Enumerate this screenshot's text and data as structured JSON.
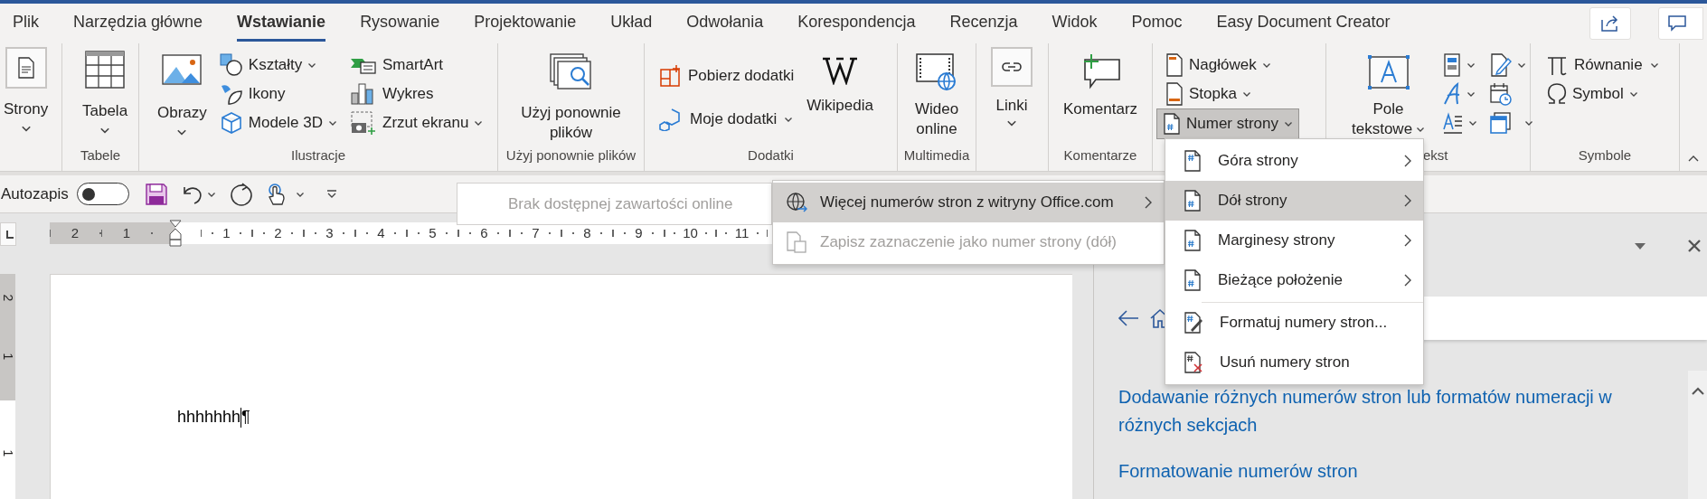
{
  "tabs": [
    {
      "label": "Plik",
      "selected": false
    },
    {
      "label": "Narzędzia główne",
      "selected": false
    },
    {
      "label": "Wstawianie",
      "selected": true
    },
    {
      "label": "Rysowanie",
      "selected": false
    },
    {
      "label": "Projektowanie",
      "selected": false
    },
    {
      "label": "Układ",
      "selected": false
    },
    {
      "label": "Odwołania",
      "selected": false
    },
    {
      "label": "Korespondencja",
      "selected": false
    },
    {
      "label": "Recenzja",
      "selected": false
    },
    {
      "label": "Widok",
      "selected": false
    },
    {
      "label": "Pomoc",
      "selected": false
    },
    {
      "label": "Easy Document Creator",
      "selected": false
    }
  ],
  "ribbon": {
    "pages": {
      "button": "Strony"
    },
    "tables": {
      "button": "Tabela",
      "label": "Tabele"
    },
    "illustrations": {
      "pictures": "Obrazy",
      "shapes": "Kształty",
      "icons": "Ikony",
      "models": "Modele 3D",
      "smartart": "SmartArt",
      "chart": "Wykres",
      "screenshot": "Zrzut ekranu",
      "label": "Ilustracje"
    },
    "reuse": {
      "button_lines": [
        "Użyj ponownie",
        "plików"
      ],
      "label": "Użyj ponownie plików"
    },
    "addins": {
      "get": "Pobierz dodatki",
      "mine": "Moje dodatki",
      "wikipedia": "Wikipedia",
      "label": "Dodatki"
    },
    "media": {
      "button_lines": [
        "Wideo",
        "online"
      ],
      "label": "Multimedia"
    },
    "links": {
      "button": "Linki"
    },
    "comments": {
      "button": "Komentarz",
      "label": "Komentarze"
    },
    "header_footer": {
      "header": "Nagłówek",
      "footer": "Stopka",
      "page_number": {
        "label": "Numer strony",
        "pressed": true
      }
    },
    "text": {
      "text_box_lines": [
        "Pole",
        "tekstowe"
      ],
      "label": "ekst"
    },
    "symbols": {
      "equation": "Równanie",
      "symbol": "Symbol",
      "label": "Symbole"
    }
  },
  "quick_access": {
    "autosave": {
      "label": "Autozapis",
      "on": false
    }
  },
  "gallery": {
    "message": "Brak dostępnej zawartości online"
  },
  "ruler": {
    "left_marks": [
      "2",
      "1"
    ],
    "right_marks": [
      "1",
      "2",
      "3",
      "4",
      "5",
      "6",
      "7",
      "8",
      "9",
      "10",
      "11"
    ]
  },
  "vertical_ruler": {
    "top_marks": [
      "2",
      "1"
    ],
    "bottom_marks": [
      "1"
    ]
  },
  "document": {
    "text": "hhhhhhh",
    "mark": "¶"
  },
  "task_pane": {
    "links": [
      "Dodawanie różnych numerów stron lub formatów numeracji w różnych sekcjach",
      "Formatowanie numerów stron"
    ]
  },
  "page_number_menu": {
    "sections": [
      [
        {
          "label": "Góra strony",
          "selected": false,
          "submenu": true
        },
        {
          "label": "Dół strony",
          "selected": true,
          "submenu": true
        },
        {
          "label": "Marginesy strony",
          "selected": false,
          "submenu": true
        },
        {
          "label": "Bieżące położenie",
          "selected": false,
          "submenu": true
        }
      ],
      [
        {
          "label": "Formatuj numery stron...",
          "selected": false,
          "submenu": false
        },
        {
          "label": "Usuń numery stron",
          "selected": false,
          "submenu": false
        }
      ]
    ]
  },
  "submenu": {
    "items": [
      {
        "label": "Więcej numerów stron z witryny Office.com",
        "selected": true,
        "disabled": false,
        "submenu": true
      },
      {
        "label": "Zapisz zaznaczenie jako numer strony (dół)",
        "selected": false,
        "disabled": true,
        "submenu": false
      }
    ]
  }
}
